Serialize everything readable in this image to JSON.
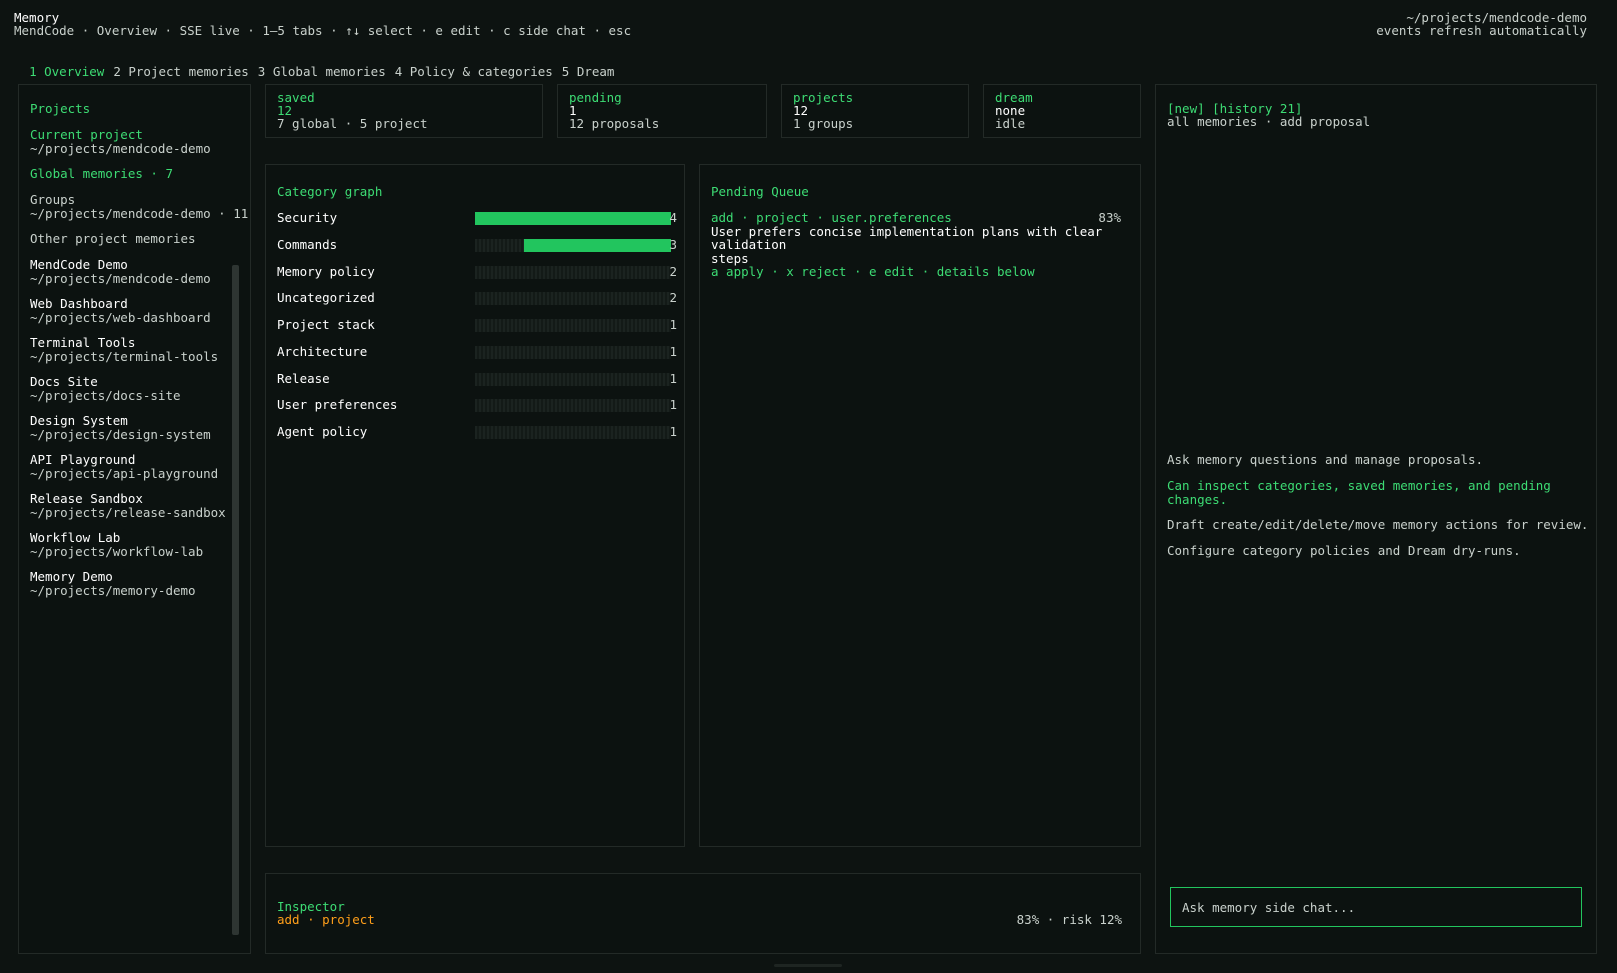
{
  "header": {
    "title": "Memory",
    "subtitle": "MendCode · Overview · SSE live · 1–5 tabs · ↑↓ select · e edit · c side chat · esc",
    "project_path": "~/projects/mendcode-demo",
    "refresh_note": "events refresh automatically"
  },
  "tabs": [
    {
      "label": "1 Overview",
      "active": true
    },
    {
      "label": "2 Project memories",
      "active": false
    },
    {
      "label": "3 Global memories",
      "active": false
    },
    {
      "label": "4 Policy & categories",
      "active": false
    },
    {
      "label": "5 Dream",
      "active": false
    }
  ],
  "sidebar": {
    "heading": "Projects",
    "current_label": "Current project",
    "current_path": "~/projects/mendcode-demo",
    "global_label": "Global memories · 7",
    "groups_label": "Groups",
    "groups_value": "~/projects/mendcode-demo · 11",
    "other_label": "Other project memories",
    "projects": [
      {
        "name": "MendCode Demo",
        "path": "~/projects/mendcode-demo"
      },
      {
        "name": "Web Dashboard",
        "path": "~/projects/web-dashboard"
      },
      {
        "name": "Terminal Tools",
        "path": "~/projects/terminal-tools"
      },
      {
        "name": "Docs Site",
        "path": "~/projects/docs-site"
      },
      {
        "name": "Design System",
        "path": "~/projects/design-system"
      },
      {
        "name": "API Playground",
        "path": "~/projects/api-playground"
      },
      {
        "name": "Release Sandbox",
        "path": "~/projects/release-sandbox"
      },
      {
        "name": "Workflow Lab",
        "path": "~/projects/workflow-lab"
      },
      {
        "name": "Memory Demo",
        "path": "~/projects/memory-demo"
      }
    ]
  },
  "stats": {
    "saved": {
      "label": "saved",
      "value": "12",
      "sub": "7 global · 5 project"
    },
    "pending": {
      "label": "pending",
      "value": "1",
      "sub": "12 proposals"
    },
    "projects": {
      "label": "projects",
      "value": "12",
      "sub": "1 groups"
    },
    "dream": {
      "label": "dream",
      "value": "none",
      "sub": "idle"
    }
  },
  "category_graph": {
    "title": "Category graph",
    "max": 4,
    "rows": [
      {
        "name": "Security",
        "count": 4
      },
      {
        "name": "Commands",
        "count": 3
      },
      {
        "name": "Memory policy",
        "count": 2
      },
      {
        "name": "Uncategorized",
        "count": 2
      },
      {
        "name": "Project stack",
        "count": 1
      },
      {
        "name": "Architecture",
        "count": 1
      },
      {
        "name": "Release",
        "count": 1
      },
      {
        "name": "User preferences",
        "count": 1
      },
      {
        "name": "Agent policy",
        "count": 1
      }
    ],
    "highlighted": 2
  },
  "pending_queue": {
    "title": "Pending Queue",
    "item": {
      "meta": "add · project · user.preferences",
      "confidence": "83%",
      "text_line1": "User prefers concise implementation plans with clear validation",
      "text_line2": "steps",
      "actions": "a apply · x reject · e edit · details below"
    }
  },
  "inspector": {
    "title": "Inspector",
    "value": "add · project",
    "right": "83% · risk 12%"
  },
  "chat": {
    "header_tags": "[new] [history 21]",
    "header_sub": "all memories · add proposal",
    "line1": "Ask memory questions and manage proposals.",
    "line2a": "Can inspect categories, saved memories, and pending",
    "line2b": "changes.",
    "line3": "Draft create/edit/delete/move memory actions for review.",
    "line4": "Configure category policies and Dream dry-runs.",
    "input_placeholder": "Ask memory side chat..."
  }
}
